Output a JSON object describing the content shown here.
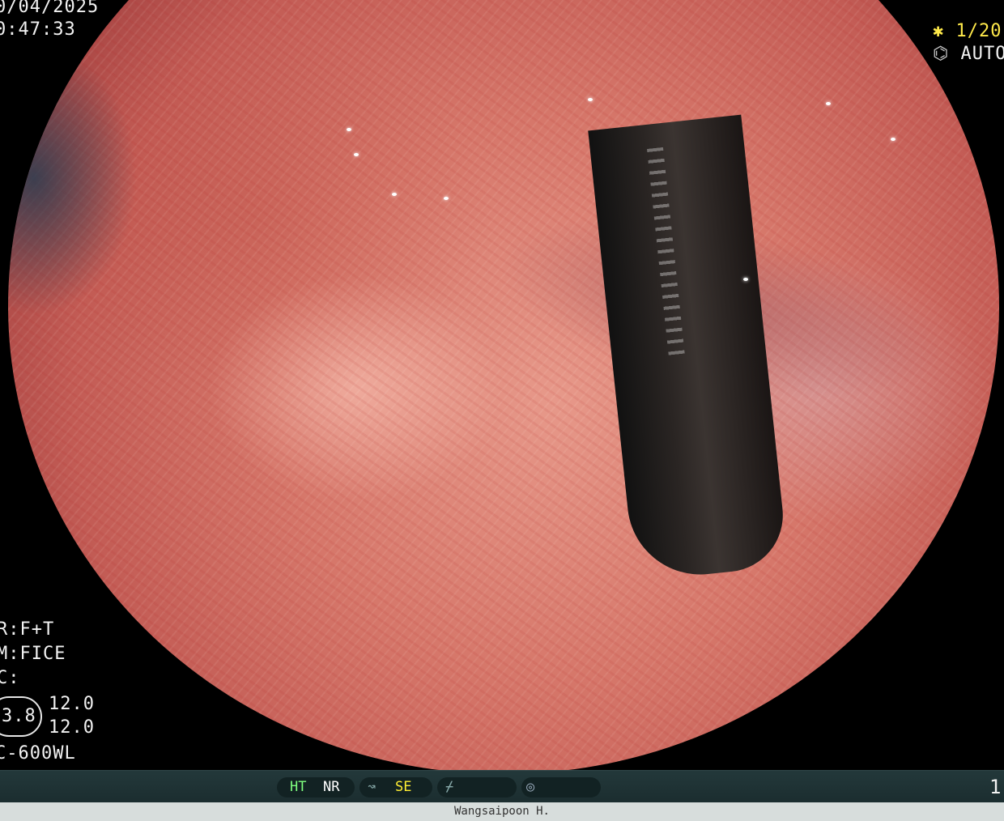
{
  "overlay": {
    "date": "0/04/2025",
    "time": "0:47:33",
    "shutter": "✱ 1/20",
    "iris": "AUTO +",
    "mode_r": "R:F+T",
    "mode_m": "M:FICE",
    "mode_c": "C:",
    "zoom": "3.8",
    "value_top": "12.0",
    "value_bottom": "12.0",
    "scope_model": "C-600WL"
  },
  "status_bar": {
    "ht": "HT",
    "nr": "NR",
    "se": "SE",
    "right_number": "1",
    "colors": {
      "ht": "#7fff7f",
      "se": "#ffee33",
      "bar_bg": "#1b2d2f"
    }
  },
  "footer": {
    "operator": "Wangsaipoon H."
  },
  "icons": [
    "shutter-icon",
    "iris-icon",
    "curve-icon",
    "pen-icon",
    "waveform-icon"
  ]
}
